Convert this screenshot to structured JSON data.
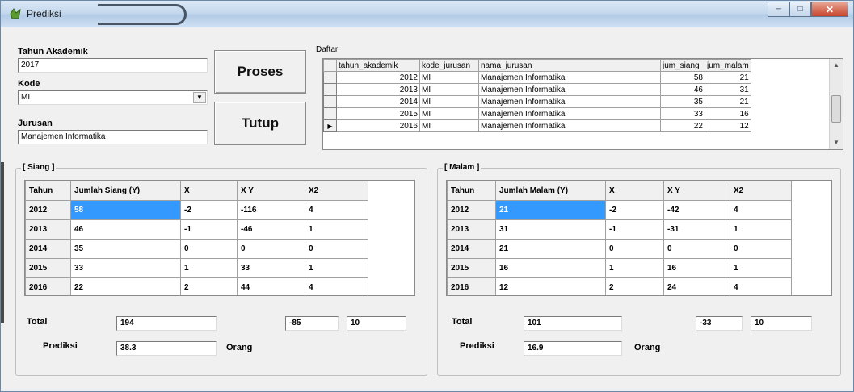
{
  "window": {
    "title": "Prediksi"
  },
  "form": {
    "tahun_label": "Tahun Akademik",
    "tahun_value": "2017",
    "kode_label": "Kode",
    "kode_value": "MI",
    "jurusan_label": "Jurusan",
    "jurusan_value": "Manajemen Informatika"
  },
  "buttons": {
    "proses": "Proses",
    "tutup": "Tutup"
  },
  "daftar": {
    "label": "Daftar",
    "columns": [
      "tahun_akademik",
      "kode_jurusan",
      "nama_jurusan",
      "jum_siang",
      "jum_malam"
    ],
    "rows": [
      [
        "2012",
        "MI",
        "Manajemen Informatika",
        "58",
        "21"
      ],
      [
        "2013",
        "MI",
        "Manajemen Informatika",
        "46",
        "31"
      ],
      [
        "2014",
        "MI",
        "Manajemen Informatika",
        "35",
        "21"
      ],
      [
        "2015",
        "MI",
        "Manajemen Informatika",
        "33",
        "16"
      ],
      [
        "2016",
        "MI",
        "Manajemen Informatika",
        "22",
        "12"
      ]
    ]
  },
  "siang": {
    "title": "[ Siang ]",
    "columns": [
      "Tahun",
      "Jumlah Siang (Y)",
      "X",
      "X Y",
      "X2"
    ],
    "rows": [
      [
        "2012",
        "58",
        "-2",
        "-116",
        "4"
      ],
      [
        "2013",
        "46",
        "-1",
        "-46",
        "1"
      ],
      [
        "2014",
        "35",
        "0",
        "0",
        "0"
      ],
      [
        "2015",
        "33",
        "1",
        "33",
        "1"
      ],
      [
        "2016",
        "22",
        "2",
        "44",
        "4"
      ]
    ],
    "total_label": "Total",
    "total_y": "194",
    "total_xy": "-85",
    "total_x2": "10",
    "prediksi_label": "Prediksi",
    "prediksi_value": "38.3",
    "orang_label": "Orang"
  },
  "malam": {
    "title": "[ Malam ]",
    "columns": [
      "Tahun",
      "Jumlah Malam (Y)",
      "X",
      "X Y",
      "X2"
    ],
    "rows": [
      [
        "2012",
        "21",
        "-2",
        "-42",
        "4"
      ],
      [
        "2013",
        "31",
        "-1",
        "-31",
        "1"
      ],
      [
        "2014",
        "21",
        "0",
        "0",
        "0"
      ],
      [
        "2015",
        "16",
        "1",
        "16",
        "1"
      ],
      [
        "2016",
        "12",
        "2",
        "24",
        "4"
      ]
    ],
    "total_label": "Total",
    "total_y": "101",
    "total_xy": "-33",
    "total_x2": "10",
    "prediksi_label": "Prediksi",
    "prediksi_value": "16.9",
    "orang_label": "Orang"
  }
}
